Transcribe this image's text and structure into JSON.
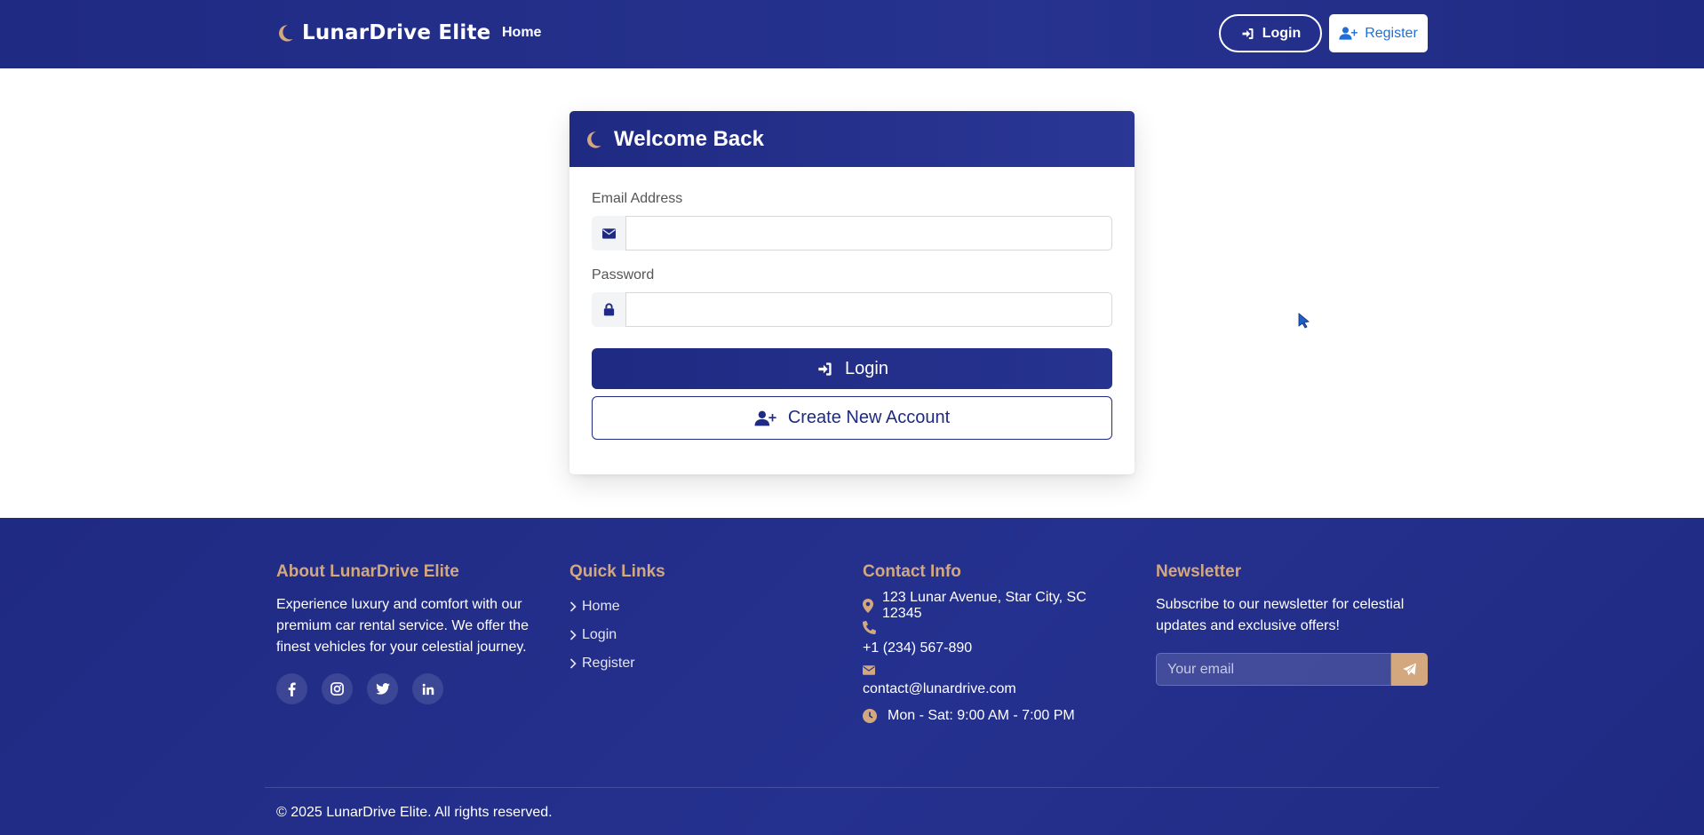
{
  "colors": {
    "primary": "#1f2a82",
    "accent": "#d3a87e",
    "link_blue": "#1e6fd9"
  },
  "navbar": {
    "brand": "LunarDrive Elite",
    "brand_icon": "moon-icon",
    "home_link": "Home",
    "login_button": "Login",
    "register_button": "Register"
  },
  "login_card": {
    "title": "Welcome Back",
    "email_label": "Email Address",
    "email_value": "",
    "password_label": "Password",
    "password_value": "",
    "login_button": "Login",
    "create_account_button": "Create New Account"
  },
  "footer": {
    "about": {
      "heading": "About LunarDrive Elite",
      "text": "Experience luxury and comfort with our premium car rental service. We offer the finest vehicles for your celestial journey.",
      "socials": [
        "facebook-icon",
        "instagram-icon",
        "twitter-icon",
        "linkedin-icon"
      ]
    },
    "quick_links": {
      "heading": "Quick Links",
      "items": [
        "Home",
        "Login",
        "Register"
      ]
    },
    "contact": {
      "heading": "Contact Info",
      "address": "123 Lunar Avenue, Star City, SC 12345",
      "phone": "+1 (234) 567-890",
      "email": "contact@lunardrive.com",
      "hours": "Mon - Sat: 9:00 AM - 7:00 PM"
    },
    "newsletter": {
      "heading": "Newsletter",
      "text": "Subscribe to our newsletter for celestial updates and exclusive offers!",
      "placeholder": "Your email"
    },
    "copyright": "© 2025 LunarDrive Elite. All rights reserved."
  }
}
